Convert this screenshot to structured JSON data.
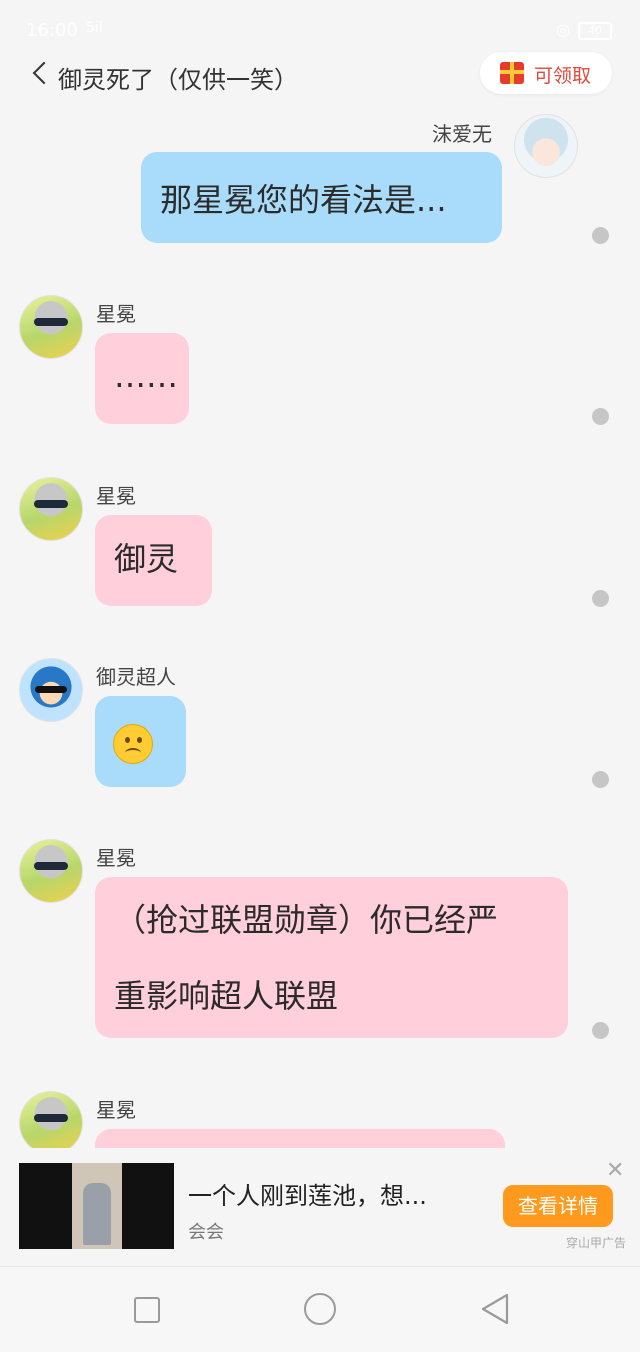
{
  "status_bar": {
    "time": "16:00",
    "signal": "5il",
    "battery": "40"
  },
  "header": {
    "title": "御灵死了（仅供一笑）",
    "claim_label": "可领取"
  },
  "messages": [
    {
      "sender": "沫爱无",
      "text": "那星冕您的看法是..."
    },
    {
      "sender": "星冕",
      "text": "……"
    },
    {
      "sender": "星冕",
      "text": "御灵"
    },
    {
      "sender": "御灵超人",
      "text": ""
    },
    {
      "sender": "星冕",
      "line1": "（抢过联盟勋章）你已经严",
      "line2": "重影响超人联盟"
    },
    {
      "sender": "星冕",
      "text": ""
    }
  ],
  "ad": {
    "title": "一个人刚到莲池，想...",
    "source": "会会",
    "button": "查看详情",
    "close": "✕",
    "tag": "穿山甲广告"
  },
  "colors": {
    "pink_bubble": "#ffcfdb",
    "blue_bubble": "#a9dcfb",
    "ad_button": "#ff9a1e"
  }
}
